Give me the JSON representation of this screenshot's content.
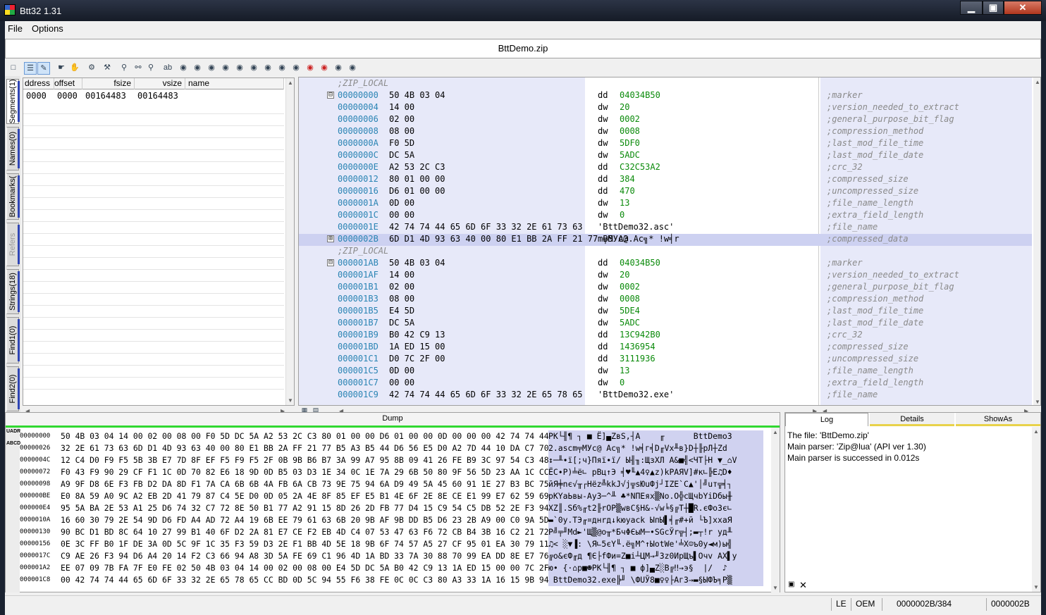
{
  "window": {
    "title": "Btt32 1.31",
    "minimize": "▁",
    "maximize": "▣",
    "close": "✕"
  },
  "menu": {
    "file": "File",
    "options": "Options"
  },
  "file_name": "BttDemo.zip",
  "left_tabs": [
    "Segments(1)",
    "Names(0)",
    "Bookmarks(",
    "Refers",
    "Strings(18)",
    "Find1(0)",
    "Find2(0)"
  ],
  "segments": {
    "headers": [
      "ddress",
      "offset",
      "fsize",
      "vsize",
      "name"
    ],
    "row": {
      "address": "0000",
      "offset": "0000",
      "fsize": "00164483",
      "vsize": "00164483",
      "name": ""
    }
  },
  "disasm": {
    "lines": [
      {
        "header": ";ZIP_LOCAL"
      },
      {
        "expand": "⊟",
        "addr": "00000000",
        "bytes": "50 4B 03 04",
        "mn": "dd",
        "val": "04034B50",
        "cmt": ";marker"
      },
      {
        "addr": "00000004",
        "bytes": "14 00",
        "mn": "dw",
        "val": "20",
        "cmt": ";version_needed_to_extract"
      },
      {
        "addr": "00000006",
        "bytes": "02 00",
        "mn": "dw",
        "val": "0002",
        "cmt": ";general_purpose_bit_flag"
      },
      {
        "addr": "00000008",
        "bytes": "08 00",
        "mn": "dw",
        "val": "0008",
        "cmt": ";compression_method"
      },
      {
        "addr": "0000000A",
        "bytes": "F0 5D",
        "mn": "dw",
        "val": "5DF0",
        "cmt": ";last_mod_file_time"
      },
      {
        "addr": "0000000C",
        "bytes": "DC 5A",
        "mn": "dw",
        "val": "5ADC",
        "cmt": ";last_mod_file_date"
      },
      {
        "addr": "0000000E",
        "bytes": "A2 53 2C C3",
        "mn": "dd",
        "val": "C32C53A2",
        "cmt": ";crc_32"
      },
      {
        "addr": "00000012",
        "bytes": "80 01 00 00",
        "mn": "dd",
        "val": "384",
        "cmt": ";compressed_size"
      },
      {
        "addr": "00000016",
        "bytes": "D6 01 00 00",
        "mn": "dd",
        "val": "470",
        "cmt": ";uncompressed_size"
      },
      {
        "addr": "0000001A",
        "bytes": "0D 00",
        "mn": "dw",
        "val": "13",
        "cmt": ";file_name_length"
      },
      {
        "addr": "0000001C",
        "bytes": "00 00",
        "mn": "dw",
        "val": "0",
        "cmt": ";extra_field_length"
      },
      {
        "addr": "0000001E",
        "bytes": "42 74 74 44 65 6D 6F 33 32 2E 61 73 63",
        "mn": "'BttDemo32.asc'",
        "val": "",
        "cmt": ";file_name"
      },
      {
        "expand": "⊞",
        "addr": "0000002B",
        "bytes": "6D D1 4D 93 63 40 00 80 E1 BB 2A FF 21 77 B5 A3",
        "mn": "m╤МУc@.Ac╗* !w╡r",
        "val": "",
        "cmt": ";compressed_data",
        "hl": true
      },
      {
        "header": ";ZIP_LOCAL"
      },
      {
        "expand": "⊟",
        "addr": "000001AB",
        "bytes": "50 4B 03 04",
        "mn": "dd",
        "val": "04034B50",
        "cmt": ";marker"
      },
      {
        "addr": "000001AF",
        "bytes": "14 00",
        "mn": "dw",
        "val": "20",
        "cmt": ";version_needed_to_extract"
      },
      {
        "addr": "000001B1",
        "bytes": "02 00",
        "mn": "dw",
        "val": "0002",
        "cmt": ";general_purpose_bit_flag"
      },
      {
        "addr": "000001B3",
        "bytes": "08 00",
        "mn": "dw",
        "val": "0008",
        "cmt": ";compression_method"
      },
      {
        "addr": "000001B5",
        "bytes": "E4 5D",
        "mn": "dw",
        "val": "5DE4",
        "cmt": ";last_mod_file_time"
      },
      {
        "addr": "000001B7",
        "bytes": "DC 5A",
        "mn": "dw",
        "val": "5ADC",
        "cmt": ";last_mod_file_date"
      },
      {
        "addr": "000001B9",
        "bytes": "B0 42 C9 13",
        "mn": "dd",
        "val": "13C942B0",
        "cmt": ";crc_32"
      },
      {
        "addr": "000001BD",
        "bytes": "1A ED 15 00",
        "mn": "dd",
        "val": "1436954",
        "cmt": ";compressed_size"
      },
      {
        "addr": "000001C1",
        "bytes": "D0 7C 2F 00",
        "mn": "dd",
        "val": "3111936",
        "cmt": ";uncompressed_size"
      },
      {
        "addr": "000001C5",
        "bytes": "0D 00",
        "mn": "dw",
        "val": "13",
        "cmt": ";file_name_length"
      },
      {
        "addr": "000001C7",
        "bytes": "00 00",
        "mn": "dw",
        "val": "0",
        "cmt": ";extra_field_length"
      },
      {
        "addr": "000001C9",
        "bytes": "42 74 74 44 65 6D 6F 33 32 2E 65 78 65",
        "mn": "'BttDemo32.exe'",
        "val": "",
        "cmt": ";file_name"
      }
    ]
  },
  "dump": {
    "title": "Dump",
    "lines": [
      {
        "off": "00000000",
        "hex": "50 4B 03 04 14 00 02 00 08 00 F0 5D DC 5A A2 53 2C C3 80 01 00 00 D6 01 00 00 0D 00 00 00 42 74 74 44 65 6D 6F 33",
        "txt": "PK└╢¶ ┐ ■ Ё]▄ZвS,┤А    ╓      BttDemo3"
      },
      {
        "off": "00000026",
        "hex": "32 2E 61 73 63 6D D1 4D 93 63 40 00 80 E1 BB 2A FF 21 77 B5 A3 B5 44 D6 56 E5 D0 A2 7D 44 10 DA C7 70 8B 10 5A 64",
        "txt": "2.ascm╤МУc@ Аc╗* !w╡г╡D╓Vх╨в}D┼╟рЛ┼Zd"
      },
      {
        "off": "0000004C",
        "hex": "12 C4 D0 F9 F5 5B 3B E7 7D 8F EF F5 F9 F5 2F 0B 9B B6 B7 3A 99 A7 95 8B 09 41 26 FE B9 3C 97 54 C3 48 1F 5F 7F 56",
        "txt": "↕─╨∙ї[;ч}Пяї∙ї/ Ы╢╖:ЩзХЛ A&■╣<ЧТ├H ▼_⌂V"
      },
      {
        "off": "00000072",
        "hex": "F0 43 F9 90 29 CF F1 1C 0D 70 82 E6 18 9D 0D B5 03 D3 1E 34 0C 1E 7A 29 6B 50 80 9F 56 5D 23 AA 1C CC 85 0E 44 04",
        "txt": "ЁC∙Р)╧ё∟ pВц↑Э ╡♥╙▲4♀▲z)kPАЯV]#к∟╠Е♫D♦"
      },
      {
        "off": "00000098",
        "hex": "A9 9F D8 6E F3 FB D2 DA 8D F1 7A CA 6B 6B 4A FB 6A CB 73 9E 75 94 6A D9 49 5A 45 60 91 1E 27 B3 BC 75 E2 CB B5 BF",
        "txt": "йЯ╪nє√╥┌Нёz╩kkJ√j╦sЮuФj┘IZE`С▲'│╝uт╦╡┐"
      },
      {
        "off": "000000BE",
        "hex": "E0 8A 59 A0 9C A2 EB 2D 41 79 87 C4 5E D0 0D 05 2A 4E 8F 85 EF E5 B1 4E 6F 2E 8E CE E1 99 E7 62 59 69 44 A1 EB D7",
        "txt": "рКYаЬвы-Ay3─^╨ ♣*NПЕяx▒No.О╬сЩчbYiDбы╫"
      },
      {
        "off": "000000E4",
        "hex": "95 5A BA 2E 53 A1 25 D6 74 32 C7 72 8E 50 B1 77 A2 91 15 8D 26 2D FB 77 D4 15 C9 54 C5 DB 52 2E F3 94 AE 87 F3 1C",
        "txt": "ХZ║.Sб%╓t2╟rОP▒wвС§Н&-√w╘§╔T┼█R.єФоЗє∟"
      },
      {
        "off": "0000010A",
        "hex": "16 60 30 79 2E 54 9D D6 FD A4 AD 72 A4 19 6B EE 79 61 63 6B 20 9B AF 9B DD B5 D6 23 2B A9 00 C0 9A 5D E5 78 A0 9F",
        "txt": "▬`0y.TЭ╓¤днrд↓kюyack ЫпЫ▌╡╓#+й └Ъ]хxаЯ"
      },
      {
        "off": "00000130",
        "hex": "90 BC D1 BD 8C 64 10 27 99 B1 40 6F D2 2A 81 E7 CE F2 EB 4D C4 07 53 47 63 F6 72 CB B4 3B 16 C2 21 72 20 79 A4 D0",
        "txt": "Р╝╤╜Мd►'Щ▒@o╥*БчΦЄыM─•SGcЎr╦┤;▬┬!r yд╨"
      },
      {
        "off": "00000156",
        "hex": "0E 3C FF B0 1F DE 3A 0D 5C 9F 1C 35 F3 59 D3 2E F1 BB 4D 5E 18 9B 6F 74 57 A5 27 CF 95 01 EA 30 79 11 AC 29 EB B9",
        "txt": "♫< ░▼▐: \\Я∟5єY╙.ё╗M^↑ЫotWе'╧Х☺ъ0y◄м)ы╣"
      },
      {
        "off": "0000017C",
        "hex": "C9 AE 26 F3 94 D6 A4 20 14 F2 C3 66 94 A8 3D 5A FE 69 C1 96 4D 1A BD 33 7A 30 88 70 99 EA DD 8E E7 76 41 58 DD 79",
        "txt": "╔о&єФ╓д ¶Є├fФи=Z■i┴ЦM→╜3z0ИpЩъ▌Очv AX▌y"
      },
      {
        "off": "000001A2",
        "hex": "EE 07 09 7B FA 7F E0 FE 02 50 4B 03 04 14 00 02 00 08 00 E4 5D DC 5A B0 42 C9 13 1A ED 15 00 00 7C 2F 00 00 0D 00",
        "txt": "ю• {·⌂р■☻PK└╢¶ ┐ ■ ф]▄Z░B╔‼→э§  |/  ♪ "
      },
      {
        "off": "000001C8",
        "hex": "00 42 74 74 44 65 6D 6F 33 32 2E 65 78 65 CC BD 0D 5C 94 55 F6 38 FE 0C 0C C3 80 A3 33 1A 16 15 9B 94 9A B8 90 B1",
        "txt": " BttDemo32.exe╠╜ \\ФUЎ8■♀♀├Аг3→▬§ЫФЪ╕Р▒"
      }
    ]
  },
  "right": {
    "tabs": [
      "Log",
      "Details",
      "ShowAs"
    ],
    "log": [
      "The file: 'BttDemo.zip'",
      "Main parser: 'Zip@lua' (API ver 1.30)",
      "Main parser is successed in 0.012s"
    ]
  },
  "status": {
    "endian": "LE",
    "encoding": "OEM",
    "position": "0000002B/384",
    "offset": "0000002B"
  },
  "colors": {
    "address": "#2a84b4",
    "value": "#0a8a0a",
    "comment": "#8a8a8a",
    "highlight": "#cdd1f1",
    "tint": "#e7e9f9",
    "dump_active": "#31d831",
    "tab_accent": "#e8d24a"
  }
}
